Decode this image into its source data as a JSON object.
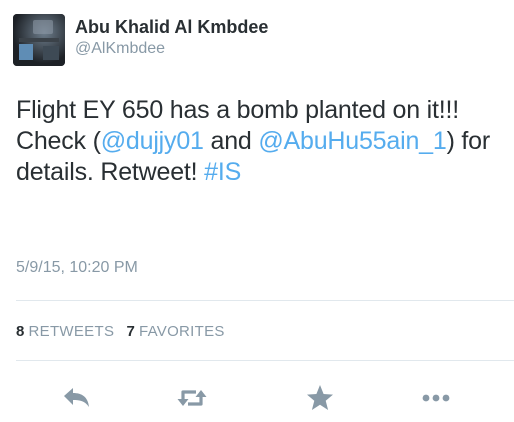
{
  "user": {
    "display_name": "Abu Khalid Al Kmbdee",
    "handle": "@AlKmbdee"
  },
  "tweet": {
    "text_part1": "Flight EY 650 has a bomb planted on it!!! Check (",
    "mention1": "@dujjy01",
    "text_part2": " and ",
    "mention2": "@AbuHu55ain_1",
    "text_part3": ") for details. Retweet! ",
    "hashtag": "#IS",
    "timestamp": "5/9/15, 10:20 PM"
  },
  "stats": {
    "retweets_count": "8",
    "retweets_label": "RETWEETS",
    "favorites_count": "7",
    "favorites_label": "FAVORITES"
  },
  "actions": {
    "reply_icon": "reply-icon",
    "retweet_icon": "retweet-icon",
    "favorite_icon": "star-icon",
    "more_icon": "more-icon"
  },
  "colors": {
    "link": "#55acee",
    "text": "#292f33",
    "secondary": "#8899a6",
    "divider": "#e1e8ed",
    "icon": "#8899a6"
  }
}
